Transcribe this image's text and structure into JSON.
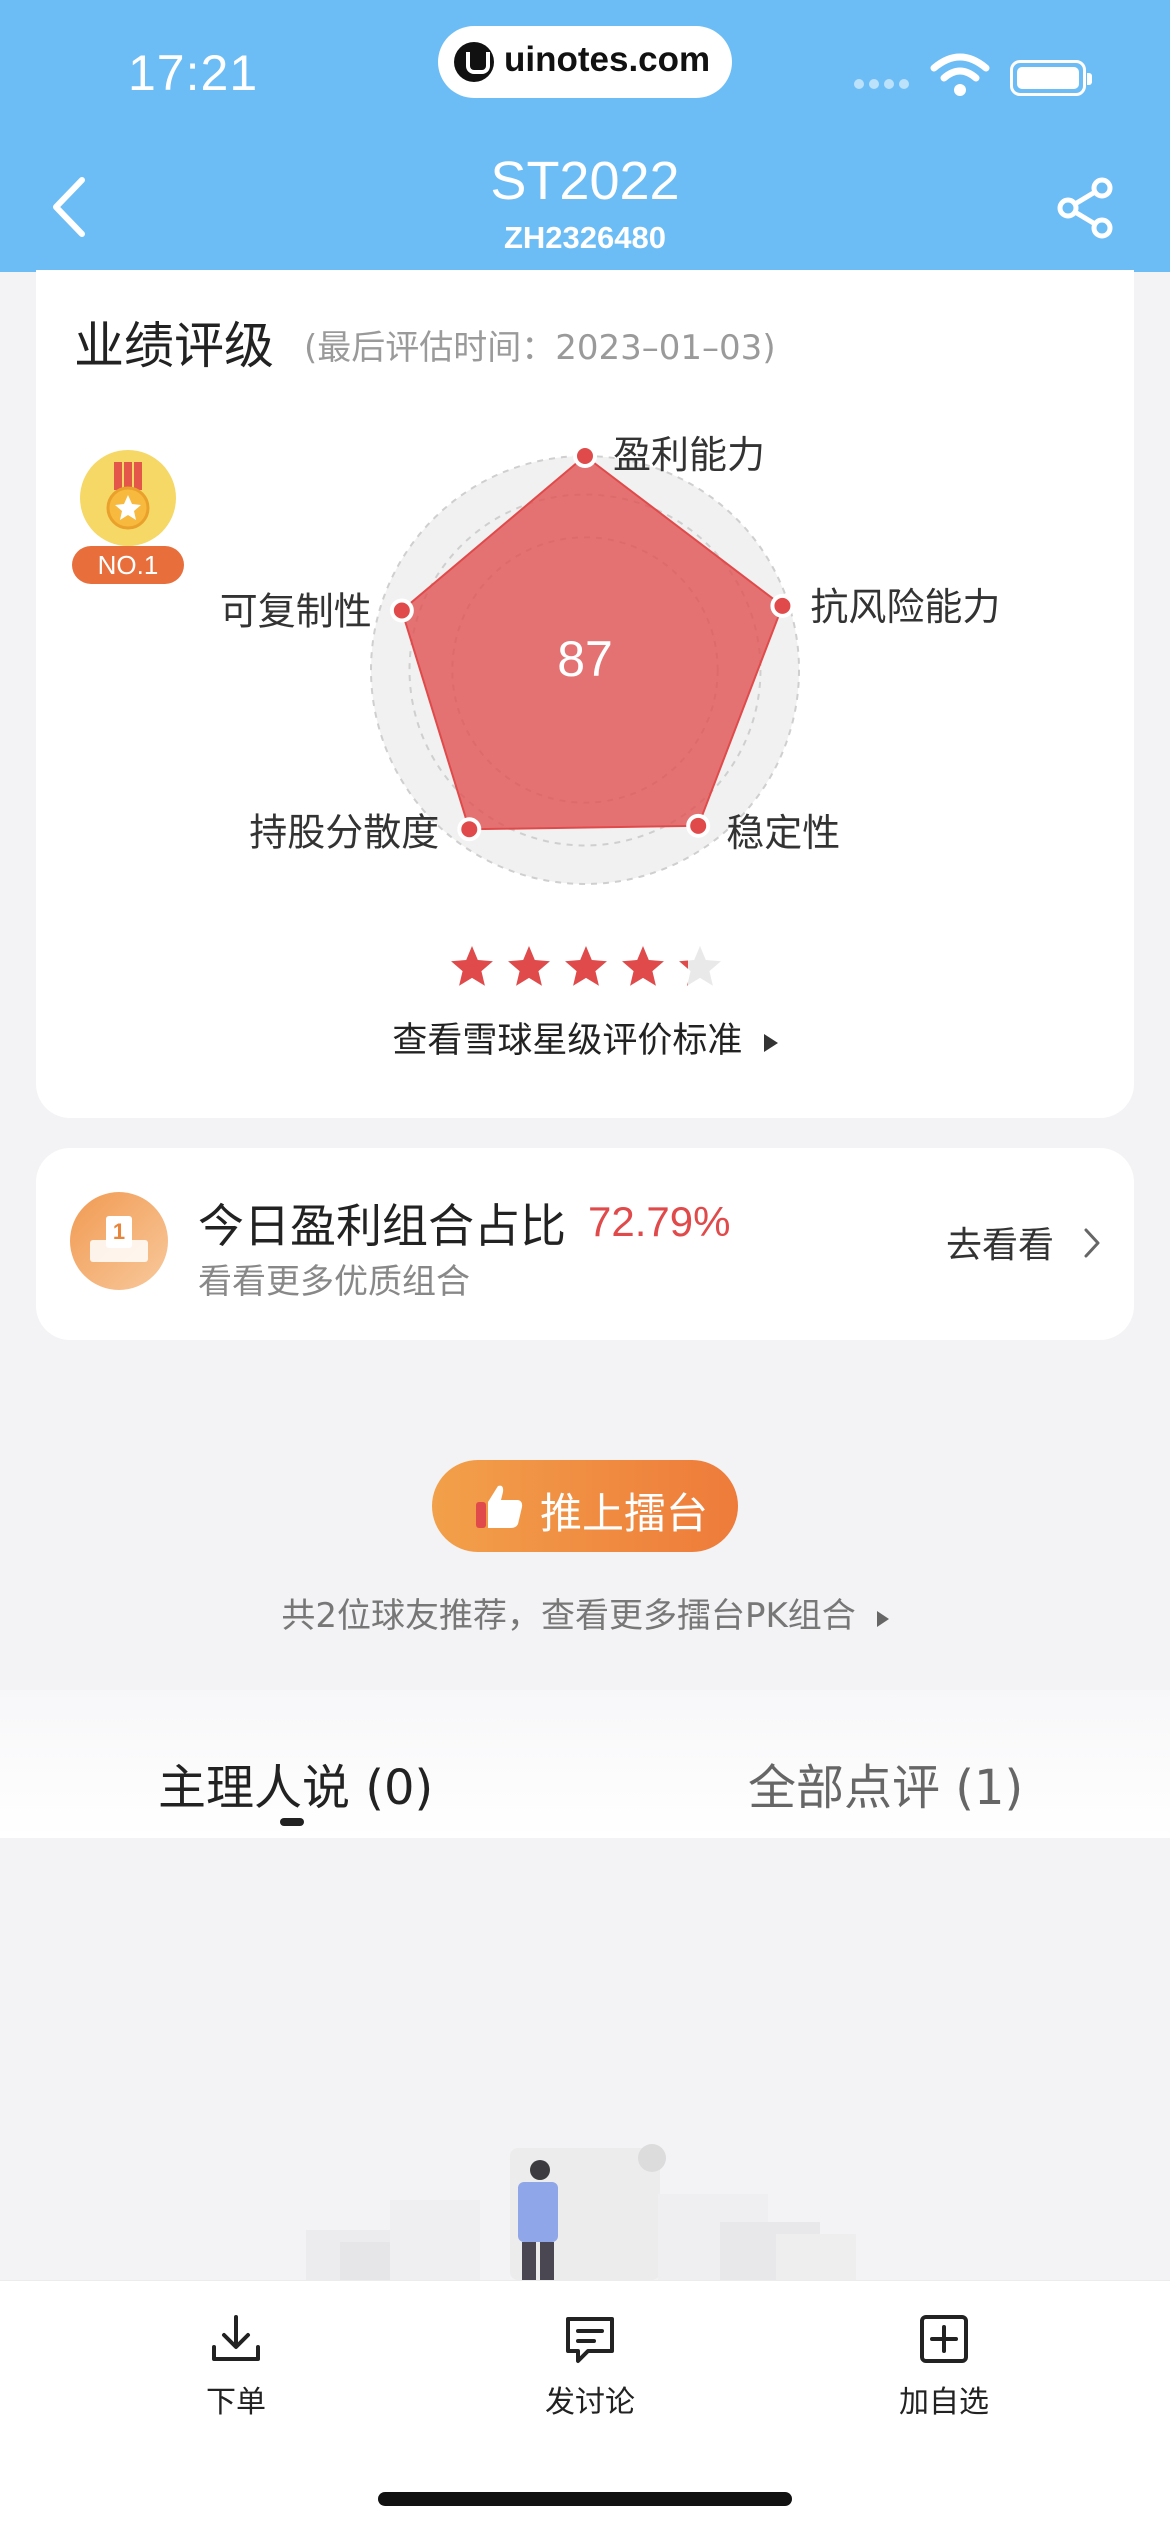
{
  "status_bar": {
    "time": "17:21",
    "url": "uinotes.com"
  },
  "header": {
    "title": "ST2022",
    "subtitle": "ZH2326480"
  },
  "rating": {
    "title": "业绩评级",
    "subtitle": "(最后评估时间：2023–01–03)",
    "badge": "NO.1",
    "score": "87",
    "dimensions": [
      "盈利能力",
      "抗风险能力",
      "稳定性",
      "持股分散度",
      "可复制性"
    ],
    "dimension_levels": [
      1.0,
      0.97,
      0.9,
      0.92,
      0.9
    ],
    "stars": 4.5,
    "link": "查看雪球星级评价标准"
  },
  "profit_card": {
    "title": "今日盈利组合占比",
    "value": "72.79%",
    "subtitle": "看看更多优质组合",
    "action": "去看看"
  },
  "recommend": {
    "button": "推上擂台",
    "text": "共2位球友推荐，查看更多擂台PK组合"
  },
  "tabs": [
    {
      "label": "主理人说 (0)",
      "active": true
    },
    {
      "label": "全部点评 (1)",
      "active": false
    }
  ],
  "bottom_bar": [
    {
      "label": "下单",
      "icon": "download-icon"
    },
    {
      "label": "发讨论",
      "icon": "chat-icon"
    },
    {
      "label": "加自选",
      "icon": "add-box-icon"
    }
  ],
  "colors": {
    "header": "#6cbdf5",
    "accent": "#e04a4a",
    "orange": "#ee7b3a"
  }
}
